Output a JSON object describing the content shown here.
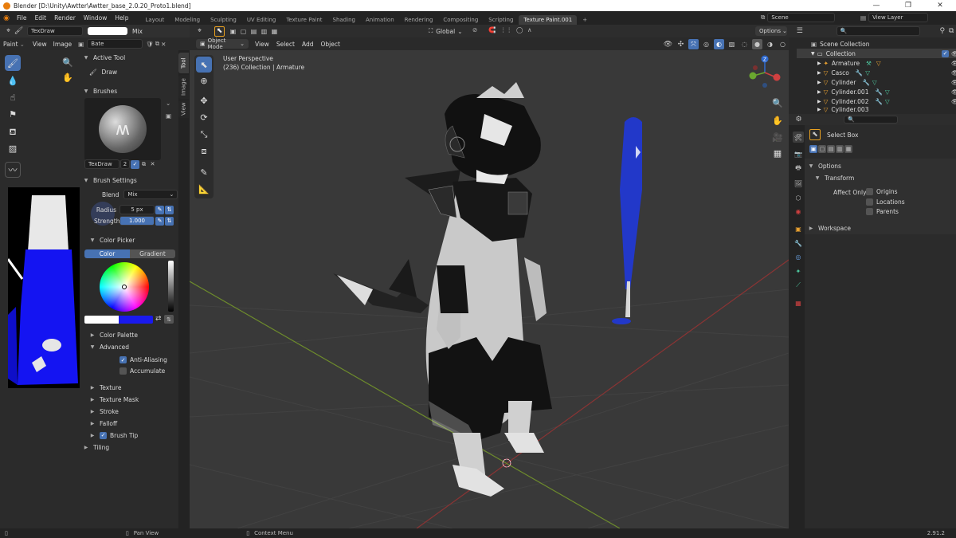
{
  "window": {
    "title": "Blender [D:\\Unity\\Awtter\\Awtter_base_2.0.20_Proto1.blend]"
  },
  "menus": [
    "File",
    "Edit",
    "Render",
    "Window",
    "Help"
  ],
  "workspaces": [
    "Layout",
    "Modeling",
    "Sculpting",
    "UV Editing",
    "Texture Paint",
    "Shading",
    "Animation",
    "Rendering",
    "Compositing",
    "Scripting",
    "Texture Paint.001"
  ],
  "active_workspace": "Texture Paint.001",
  "scene": {
    "label": "Scene",
    "view_layer": "View Layer"
  },
  "image_editor": {
    "mode": "Paint",
    "view": "View",
    "image": "Image",
    "image_name": "Bate",
    "brush_name": "TexDraw",
    "blend_mode": "Mix"
  },
  "sidebar": {
    "tabs": [
      "Tool",
      "Image",
      "View"
    ],
    "active_tool_title": "Active Tool",
    "active_tool_name": "Draw",
    "brushes_title": "Brushes",
    "brush_name": "TexDraw",
    "brush_users": "2",
    "brush_settings_title": "Brush Settings",
    "blend_label": "Blend",
    "blend_value": "Mix",
    "radius_label": "Radius",
    "radius_value": "5 px",
    "strength_label": "Strength",
    "strength_value": "1.000",
    "color_picker_title": "Color Picker",
    "color_tab": "Color",
    "gradient_tab": "Gradient",
    "color_palette_title": "Color Palette",
    "advanced_title": "Advanced",
    "anti_aliasing": "Anti-Aliasing",
    "accumulate": "Accumulate",
    "texture": "Texture",
    "texture_mask": "Texture Mask",
    "stroke": "Stroke",
    "falloff": "Falloff",
    "brush_tip": "Brush Tip",
    "tiling": "Tiling",
    "primary_color": "#ffffff",
    "secondary_color": "#1a1aee"
  },
  "viewport": {
    "mode": "Object Mode",
    "menus": [
      "View",
      "Select",
      "Add",
      "Object"
    ],
    "orientation": "Global",
    "options": "Options",
    "perspective_label": "User Perspective",
    "collection_label": "(236) Collection | Armature"
  },
  "outliner": {
    "scene_collection": "Scene Collection",
    "collection": "Collection",
    "items": [
      "Armature",
      "Casco",
      "Cylinder",
      "Cylinder.001",
      "Cylinder.002",
      "Cylinder.003"
    ]
  },
  "properties": {
    "tool_name": "Select Box",
    "options_title": "Options",
    "transform_title": "Transform",
    "affect_only_label": "Affect Only",
    "origins": "Origins",
    "locations": "Locations",
    "parents": "Parents",
    "workspace_title": "Workspace"
  },
  "statusbar": {
    "pan_view": "Pan View",
    "context_menu": "Context Menu",
    "version": "2.91.2"
  },
  "colors": {
    "accent": "#4772b3",
    "bat_blue": "#1f3fcc",
    "grid_x": "#8a3434",
    "grid_y": "#6d8b2c"
  }
}
